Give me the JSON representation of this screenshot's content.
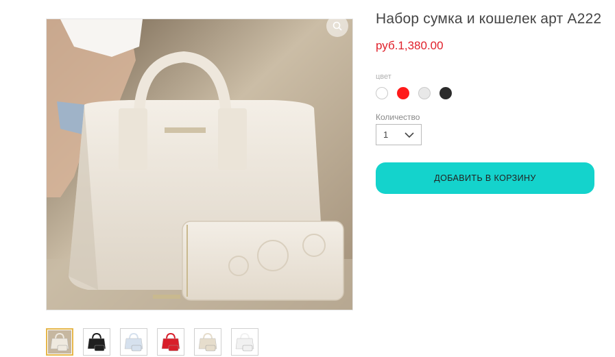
{
  "product": {
    "title": "Набор сумка и кошелек арт A222",
    "price": "руб.1,380.00"
  },
  "options": {
    "color_label": "цвет",
    "colors": [
      {
        "name": "white",
        "hex": "#ffffff"
      },
      {
        "name": "red",
        "hex": "#ff1a1a"
      },
      {
        "name": "light-gray",
        "hex": "#e8e8e8"
      },
      {
        "name": "black",
        "hex": "#2b2b2b"
      }
    ],
    "quantity_label": "Количество",
    "quantity_value": "1"
  },
  "actions": {
    "add_to_cart_label": "ДОБАВИТЬ В КОРЗИНУ",
    "add_to_cart_color": "#14d3cc"
  },
  "gallery": {
    "thumbnails": [
      {
        "variant": "cream",
        "bag_color": "#efe9df"
      },
      {
        "variant": "black",
        "bag_color": "#1f1f1f"
      },
      {
        "variant": "light-blue",
        "bag_color": "#d6e1ee"
      },
      {
        "variant": "red",
        "bag_color": "#d81e2a"
      },
      {
        "variant": "beige",
        "bag_color": "#e6ddcc"
      },
      {
        "variant": "white",
        "bag_color": "#f1f1f1"
      }
    ],
    "active_index": 0
  }
}
